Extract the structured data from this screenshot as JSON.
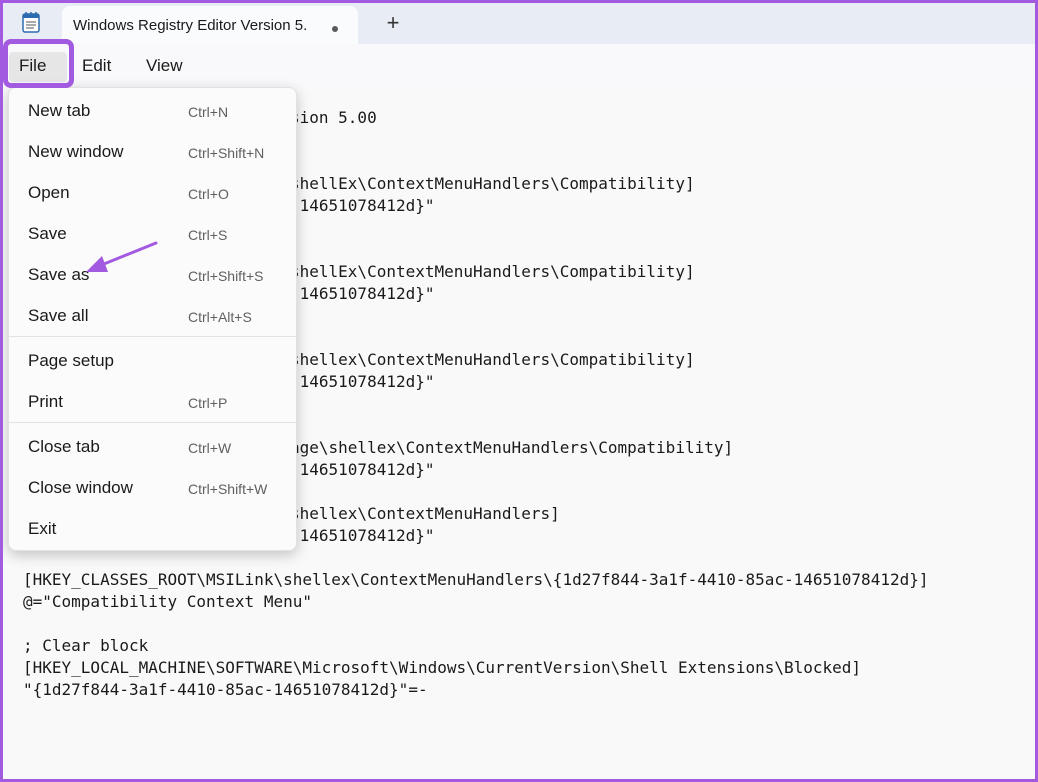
{
  "window": {
    "tab_title": "Windows Registry Editor Version 5.",
    "new_tab_glyph": "+",
    "app_icon": "notepad-icon"
  },
  "menubar": {
    "items": [
      "File",
      "Edit",
      "View"
    ]
  },
  "file_menu": {
    "groups": [
      [
        {
          "label": "New tab",
          "shortcut": "Ctrl+N"
        },
        {
          "label": "New window",
          "shortcut": "Ctrl+Shift+N"
        },
        {
          "label": "Open",
          "shortcut": "Ctrl+O"
        },
        {
          "label": "Save",
          "shortcut": "Ctrl+S"
        },
        {
          "label": "Save as",
          "shortcut": "Ctrl+Shift+S"
        },
        {
          "label": "Save all",
          "shortcut": "Ctrl+Alt+S"
        }
      ],
      [
        {
          "label": "Page setup",
          "shortcut": ""
        },
        {
          "label": "Print",
          "shortcut": "Ctrl+P"
        }
      ],
      [
        {
          "label": "Close tab",
          "shortcut": "Ctrl+W"
        },
        {
          "label": "Close window",
          "shortcut": "Ctrl+Shift+W"
        },
        {
          "label": "Exit",
          "shortcut": ""
        }
      ]
    ]
  },
  "editor": {
    "lines": [
      {
        "x": "right",
        "text": "sion 5.00"
      },
      {
        "x": "right",
        "text": "shellEx\\ContextMenuHandlers\\Compatibility]"
      },
      {
        "x": "right",
        "text": "-14651078412d}\""
      },
      {
        "x": "right",
        "text": "shellEx\\ContextMenuHandlers\\Compatibility]"
      },
      {
        "x": "right",
        "text": "-14651078412d}\""
      },
      {
        "x": "right",
        "text": "shellex\\ContextMenuHandlers\\Compatibility]"
      },
      {
        "x": "right",
        "text": "-14651078412d}\""
      },
      {
        "x": "right",
        "text": "age\\shellex\\ContextMenuHandlers\\Compatibility]"
      },
      {
        "x": "right",
        "text": "-14651078412d}\""
      },
      {
        "x": "right",
        "text": "shellex\\ContextMenuHandlers]"
      },
      {
        "x": "right",
        "text": "-14651078412d}\""
      },
      {
        "x": "full",
        "text": "[HKEY_CLASSES_ROOT\\MSILink\\shellex\\ContextMenuHandlers\\{1d27f844-3a1f-4410-85ac-14651078412d}]"
      },
      {
        "x": "full",
        "text": "@=\"Compatibility Context Menu\""
      },
      {
        "x": "full",
        "text": "; Clear block"
      },
      {
        "x": "full",
        "text": "[HKEY_LOCAL_MACHINE\\SOFTWARE\\Microsoft\\Windows\\CurrentVersion\\Shell Extensions\\Blocked]"
      },
      {
        "x": "full",
        "text": "\"{1d27f844-3a1f-4410-85ac-14651078412d}\"=-"
      }
    ]
  },
  "annotation": {
    "highlight_color": "#a25be0"
  }
}
